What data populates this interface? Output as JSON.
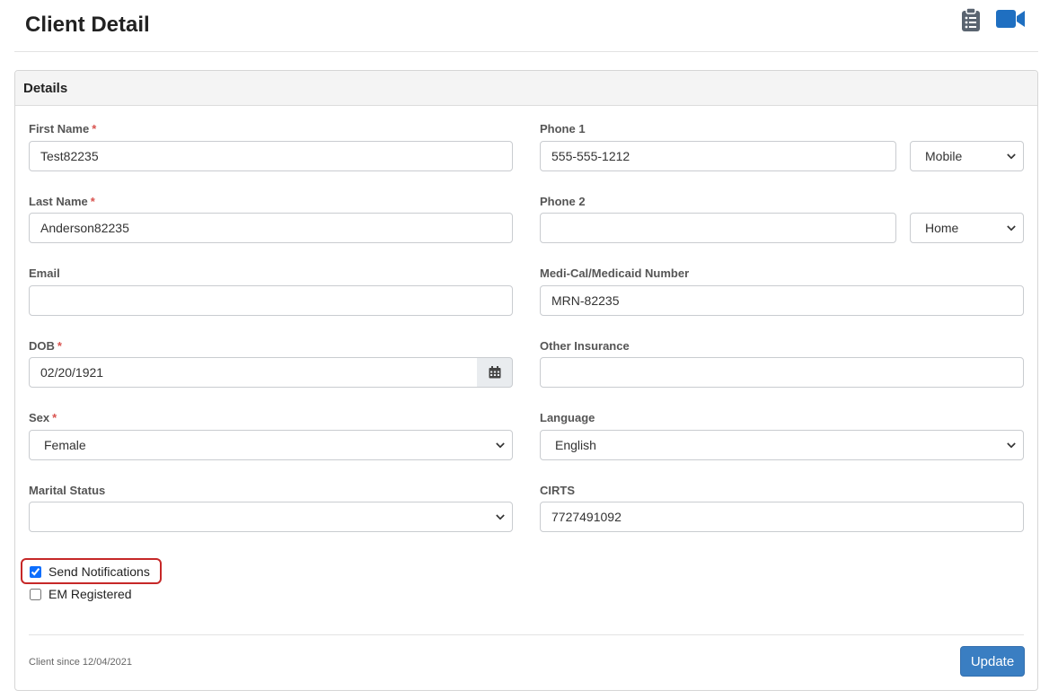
{
  "page": {
    "title": "Client Detail",
    "icons": [
      "clipboard-list-icon",
      "video-camera-icon"
    ]
  },
  "card": {
    "header": "Details"
  },
  "fields": {
    "first_name": {
      "label": "First Name",
      "required_mark": "*",
      "value": "Test82235"
    },
    "last_name": {
      "label": "Last Name",
      "required_mark": "*",
      "value": "Anderson82235"
    },
    "email": {
      "label": "Email",
      "value": ""
    },
    "dob": {
      "label": "DOB",
      "required_mark": "*",
      "value": "02/20/1921",
      "icon": "calendar-icon"
    },
    "sex": {
      "label": "Sex",
      "required_mark": "*",
      "value": "Female"
    },
    "marital_status": {
      "label": "Marital Status",
      "value": ""
    },
    "phone1": {
      "label": "Phone 1",
      "value": "555-555-1212",
      "type": "Mobile"
    },
    "phone2": {
      "label": "Phone 2",
      "value": "",
      "type": "Home"
    },
    "medicaid": {
      "label": "Medi-Cal/Medicaid Number",
      "value": "MRN-82235"
    },
    "other_insurance": {
      "label": "Other Insurance",
      "value": ""
    },
    "language": {
      "label": "Language",
      "value": "English"
    },
    "cirts": {
      "label": "CIRTS",
      "value": "7727491092"
    }
  },
  "checkboxes": {
    "send_notifications": {
      "label": "Send Notifications",
      "checked": true
    },
    "em_registered": {
      "label": "EM Registered",
      "checked": false
    }
  },
  "footer": {
    "client_since": "Client since 12/04/2021",
    "update_label": "Update"
  },
  "colors": {
    "primary_button": "#3a7ec2",
    "icon_blue": "#1f6fc1",
    "required": "#d9534f",
    "highlight_border": "#c62828"
  }
}
